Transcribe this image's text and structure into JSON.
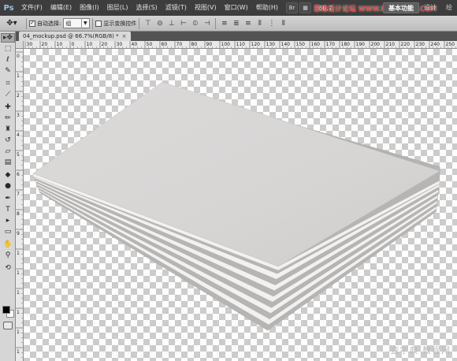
{
  "app": {
    "logo": "Ps",
    "menu": [
      "文件(F)",
      "编辑(E)",
      "图像(I)",
      "图层(L)",
      "选择(S)",
      "滤镜(T)",
      "视图(V)",
      "窗口(W)",
      "帮助(H)"
    ],
    "zoom": "66.7",
    "workspaces": [
      "基本功能",
      "设计",
      "绘"
    ],
    "active_workspace_index": 0,
    "watermark": "思缘设计论坛 WWW.MISSYUAN.COM"
  },
  "options": {
    "auto_select_label": "自动选择:",
    "auto_select_checked": true,
    "auto_select_value": "组",
    "transform_label": "显示变换控件",
    "transform_checked": false
  },
  "document": {
    "tab_title": "04_mockup.psd @ 66.7%(RGB/8) *",
    "close_symbol": "×"
  },
  "rulers": {
    "horizontal": [
      "30",
      "20",
      "10",
      "0",
      "10",
      "20",
      "30",
      "40",
      "50",
      "60",
      "70",
      "80",
      "90",
      "100",
      "110",
      "120",
      "130",
      "140",
      "150",
      "160",
      "170",
      "180",
      "190",
      "200",
      "210",
      "220",
      "230",
      "240",
      "250"
    ],
    "vertical": [
      "0",
      "1",
      "2",
      "3",
      "4",
      "5",
      "6",
      "7",
      "8",
      "9",
      "1",
      "1",
      "1",
      "1",
      "1",
      "1"
    ]
  },
  "tools": [
    "move-tool-icon",
    "marquee-tool-icon",
    "lasso-tool-icon",
    "quick-select-tool-icon",
    "crop-tool-icon",
    "eyedropper-tool-icon",
    "healing-brush-tool-icon",
    "brush-tool-icon",
    "clone-stamp-tool-icon",
    "history-brush-tool-icon",
    "eraser-tool-icon",
    "gradient-tool-icon",
    "blur-tool-icon",
    "dodge-tool-icon",
    "pen-tool-icon",
    "type-tool-icon",
    "path-select-tool-icon",
    "shape-tool-icon",
    "hand-tool-icon",
    "zoom-tool-icon"
  ],
  "colors": {
    "foreground": "#000000",
    "background": "#ffffff",
    "card_face": "#d7d5d4",
    "card_edge": "#f2f1f0"
  },
  "canvas_watermark": "查字典 教程网"
}
